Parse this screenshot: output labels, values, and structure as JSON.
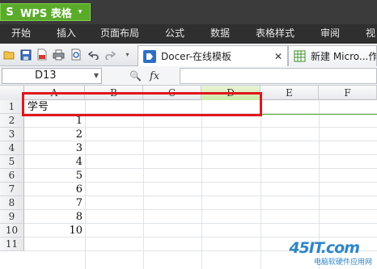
{
  "app": {
    "name": "WPS 表格",
    "logo_letter": "S",
    "caret": "▾",
    "accent_color": "#5bab2b"
  },
  "menu": {
    "items": [
      "开始",
      "插入",
      "页面布局",
      "公式",
      "数据",
      "表格样式",
      "审阅",
      "视"
    ]
  },
  "toolbar": {
    "icons": [
      "open-folder-icon",
      "save-icon",
      "pdf-export-icon",
      "print-icon",
      "print-preview-icon",
      "undo-icon",
      "redo-icon",
      "dropdown-icon"
    ]
  },
  "tabs": [
    {
      "label": "Docer-在线模板",
      "icon": "docer-icon",
      "close": "✕"
    },
    {
      "label": "新建 Micro...作表",
      "icon": "spreadsheet-icon"
    }
  ],
  "formula_bar": {
    "name_box": "D13",
    "zoom_glyph": "🔍",
    "fx_label": "fx",
    "formula": ""
  },
  "sheet": {
    "columns": [
      "A",
      "B",
      "C",
      "D",
      "E",
      "F"
    ],
    "selected_column": "D",
    "rows": [
      "1",
      "2",
      "3",
      "4",
      "5",
      "6",
      "7",
      "8",
      "9",
      "10",
      "11"
    ],
    "column_a": [
      "学号",
      "1",
      "2",
      "3",
      "4",
      "5",
      "6",
      "7",
      "8",
      "10",
      ""
    ],
    "highlight_color": "#e0161b"
  },
  "watermark": {
    "logo": "45IT.com",
    "subtitle": "电脑软硬件应用网"
  }
}
